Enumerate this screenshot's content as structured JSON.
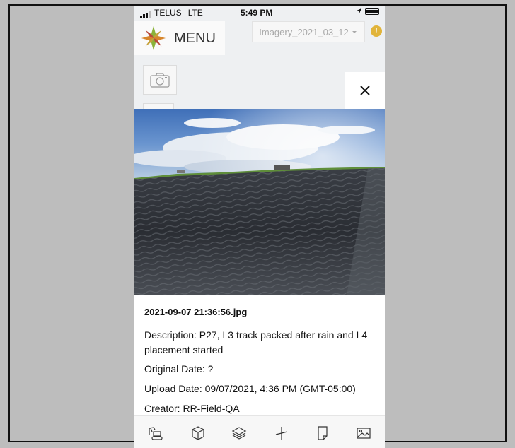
{
  "status_bar": {
    "carrier": "TELUS",
    "network": "LTE",
    "time": "5:49 PM"
  },
  "header": {
    "menu_label": "MENU",
    "imagery_selected": "Imagery_2021_03_12",
    "alert_symbol": "!"
  },
  "photo_panel": {
    "filename": "2021-09-07 21:36:56.jpg",
    "description": "Description: P27, L3 track packed after rain and L4 placement started",
    "original_date": "Original Date: ?",
    "upload_date": "Upload Date: 09/07/2021, 4:36 PM (GMT-05:00)",
    "creator": "Creator: RR-Field-QA"
  },
  "toolbar": {
    "icons": [
      "excavator-icon",
      "cube-icon",
      "layers-icon",
      "measure-icon",
      "page-icon",
      "image-icon"
    ]
  },
  "colors": {
    "background": "#bdbdbd",
    "app_background": "#eef0f2",
    "alert": "#e1b43a",
    "logo_green": "#8bb33a",
    "logo_orange": "#d7862b",
    "logo_red": "#b94a3a"
  }
}
